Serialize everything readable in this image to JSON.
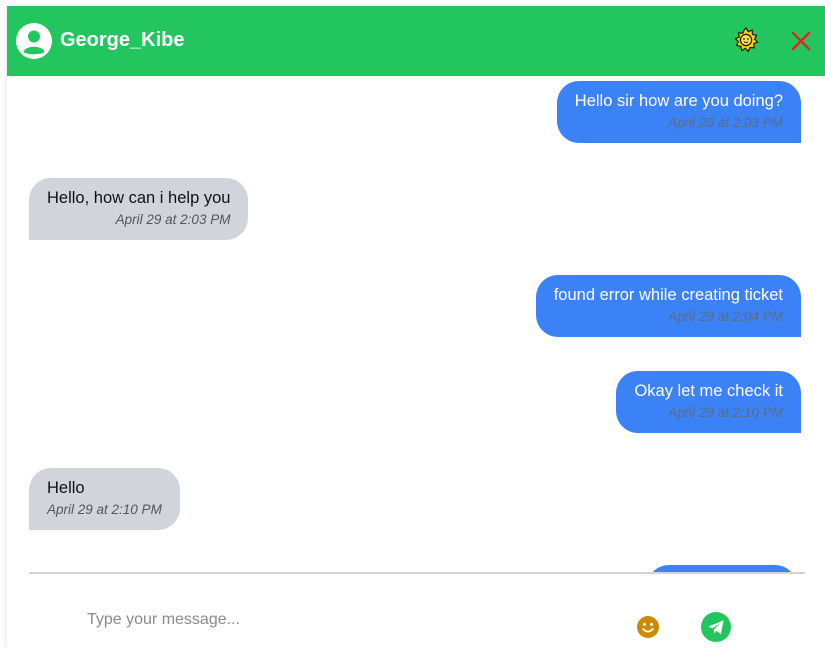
{
  "header": {
    "username": "George_Kibe",
    "accent_color": "#22c55e",
    "avatar_icon": "user-circle-icon",
    "theme_icon": "sun-icon",
    "close_icon": "close-icon"
  },
  "messages": [
    {
      "direction": "out",
      "text": "Hello sir how are you doing?",
      "time": "April 29 at 2:03 PM"
    },
    {
      "direction": "in",
      "text": "Hello, how can i help you",
      "time": "April 29 at 2:03 PM"
    },
    {
      "direction": "out",
      "text": "found error while creating ticket",
      "time": "April 29 at 2:04 PM"
    },
    {
      "direction": "out",
      "text": "Okay let me check it",
      "time": "April 29 at 2:10 PM"
    },
    {
      "direction": "in",
      "text": "Hello",
      "time": "April 29 at 2:10 PM"
    }
  ],
  "composer": {
    "placeholder": "Type your message...",
    "value": "",
    "emoji_icon": "smiley-icon",
    "send_icon": "send-icon"
  },
  "colors": {
    "outgoing_bubble": "#3b82f6",
    "incoming_bubble": "#d1d5db"
  }
}
